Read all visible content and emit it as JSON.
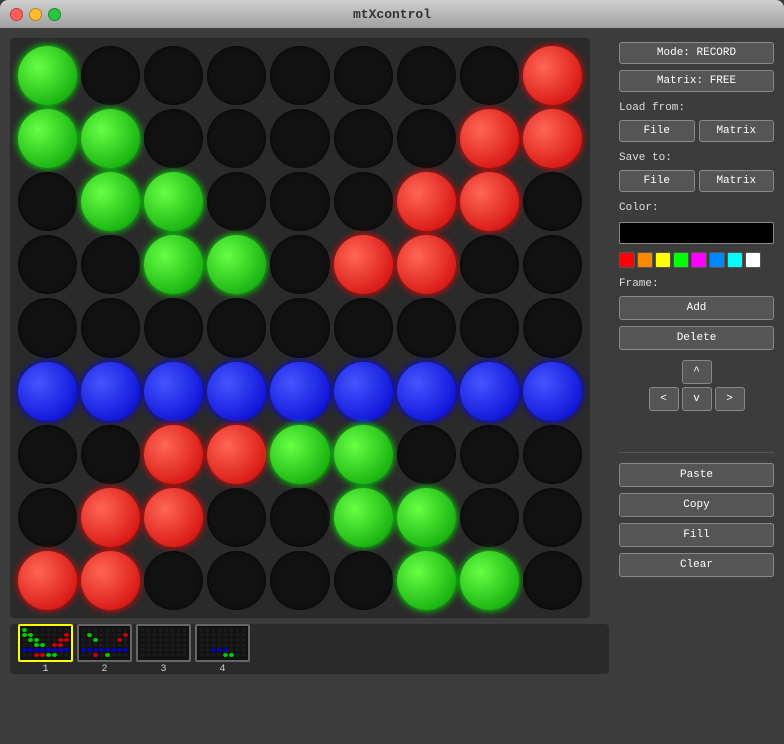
{
  "titleBar": {
    "title": "mtXcontrol"
  },
  "controls": {
    "mode_label": "Mode: RECORD",
    "matrix_label": "Matrix: FREE",
    "load_from": "Load from:",
    "load_file": "File",
    "load_matrix": "Matrix",
    "save_to": "Save to:",
    "save_file": "File",
    "save_matrix": "Matrix",
    "color_label": "Color:",
    "frame_label": "Frame:",
    "frame_add": "Add",
    "frame_delete": "Delete",
    "nav_up": "^",
    "nav_down": "v",
    "nav_left": "<",
    "nav_right": ">",
    "paste": "Paste",
    "copy": "Copy",
    "fill": "Fill",
    "clear": "Clear"
  },
  "palette": [
    {
      "color": "#ff0000",
      "name": "red"
    },
    {
      "color": "#ff8800",
      "name": "orange"
    },
    {
      "color": "#ffff00",
      "name": "yellow"
    },
    {
      "color": "#00ff00",
      "name": "green"
    },
    {
      "color": "#ff00ff",
      "name": "magenta"
    },
    {
      "color": "#0088ff",
      "name": "blue"
    },
    {
      "color": "#00ffff",
      "name": "cyan"
    },
    {
      "color": "#ffffff",
      "name": "white"
    }
  ],
  "frames": [
    {
      "id": 1,
      "label": "1",
      "active": true
    },
    {
      "id": 2,
      "label": "2",
      "active": false
    },
    {
      "id": 3,
      "label": "3",
      "active": false
    },
    {
      "id": 4,
      "label": "4",
      "active": false
    }
  ],
  "grid": {
    "rows": 9,
    "cols": 9,
    "cells": [
      "green",
      "black",
      "black",
      "black",
      "black",
      "black",
      "black",
      "black",
      "red",
      "green",
      "green",
      "black",
      "black",
      "black",
      "black",
      "black",
      "red",
      "red",
      "black",
      "green",
      "green",
      "black",
      "black",
      "black",
      "red",
      "red",
      "black",
      "black",
      "black",
      "green",
      "green",
      "black",
      "red",
      "red",
      "black",
      "black",
      "black",
      "black",
      "black",
      "black",
      "black",
      "black",
      "black",
      "black",
      "black",
      "blue",
      "blue",
      "blue",
      "blue",
      "blue",
      "blue",
      "blue",
      "blue",
      "blue",
      "black",
      "black",
      "red",
      "red",
      "green",
      "green",
      "black",
      "black",
      "black",
      "black",
      "red",
      "red",
      "black",
      "black",
      "green",
      "green",
      "black",
      "black",
      "red",
      "red",
      "black",
      "black",
      "black",
      "black",
      "green",
      "green",
      "black"
    ]
  }
}
